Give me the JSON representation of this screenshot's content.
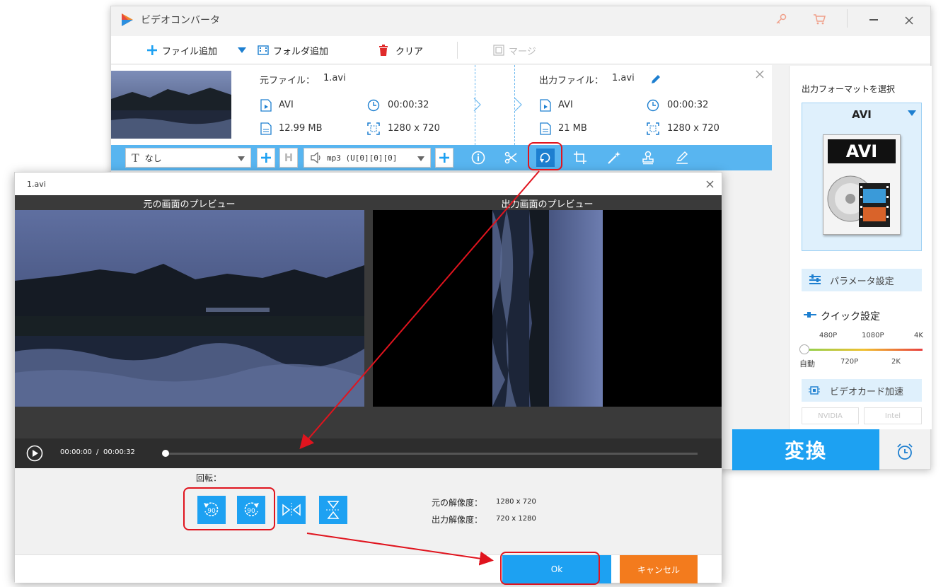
{
  "app": {
    "title": "ビデオコンバータ",
    "accent": "#1da1f2"
  },
  "toolbar": {
    "add_file": "ファイル追加",
    "add_folder": "フォルダ追加",
    "clear": "クリア",
    "merge": "マージ"
  },
  "file": {
    "source_label": "元ファイル：",
    "source_name": "1.avi",
    "source_format": "AVI",
    "source_duration": "00:00:32",
    "source_size": "12.99 MB",
    "source_resolution": "1280 x 720",
    "output_label": "出力ファイル：",
    "output_name": "1.avi",
    "output_format": "AVI",
    "output_duration": "00:00:32",
    "output_size": "21 MB",
    "output_resolution": "1280 x 720"
  },
  "editbar": {
    "subtitle": "なし",
    "audio": "mp3 (U[0][0][0]"
  },
  "right": {
    "format_title": "出力フォーマットを選択",
    "format_name": "AVI",
    "format_badge": "AVI",
    "param_settings": "パラメータ設定",
    "quick_settings": "クイック設定",
    "slider_top": [
      "480P",
      "1080P",
      "4K"
    ],
    "slider_bottom": [
      "自動",
      "720P",
      "2K"
    ],
    "gpu_accel": "ビデオカード加速",
    "nvidia": "NVIDIA",
    "intel": "Intel",
    "convert": "変換"
  },
  "dialog": {
    "title": "1.avi",
    "orig_preview": "元の画面のプレビュー",
    "out_preview": "出力画面のプレビュー",
    "time_current": "00:00:00",
    "time_sep": "/",
    "time_total": "00:00:32",
    "rotate_label": "回転：",
    "rot_left": "90",
    "rot_right": "90",
    "orig_res_label": "元の解像度：",
    "orig_res": "1280 x 720",
    "out_res_label": "出力解像度：",
    "out_res": "720 x 1280",
    "ok": "Ok",
    "cancel": "キャンセル"
  }
}
